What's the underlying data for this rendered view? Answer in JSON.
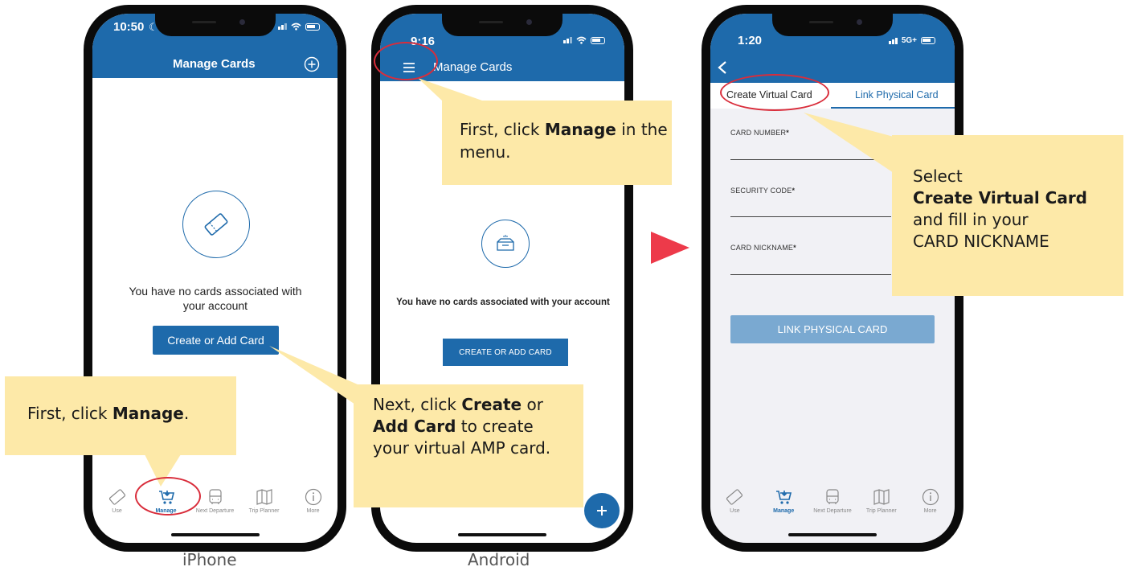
{
  "iphone": {
    "status_time": "10:50",
    "nav_title": "Manage Cards",
    "add_icon": "plus-circle-icon",
    "empty_message": "You have no cards associated with your account",
    "button_label": "Create or Add Card",
    "tabs": [
      {
        "label": "Use",
        "icon": "ticket-icon"
      },
      {
        "label": "Manage",
        "icon": "cart-icon",
        "active": true
      },
      {
        "label": "Next Departure",
        "icon": "bus-icon"
      },
      {
        "label": "Trip Planner",
        "icon": "map-icon"
      },
      {
        "label": "More",
        "icon": "info-icon"
      }
    ],
    "caption": "iPhone"
  },
  "android": {
    "status_time": "9:16",
    "nav_title": "Manage Cards",
    "menu_icon": "hamburger-icon",
    "empty_message": "You have no cards associated with your account",
    "button_label": "CREATE OR ADD CARD",
    "fab_icon": "plus-icon",
    "caption": "Android"
  },
  "virtual_card": {
    "status_time": "1:20",
    "network": "5G+",
    "back_icon": "chevron-left-icon",
    "tabs": [
      {
        "label": "Create Virtual Card"
      },
      {
        "label": "Link Physical Card",
        "active": true
      }
    ],
    "fields": [
      {
        "label": "CARD NUMBER",
        "required": "*"
      },
      {
        "label": "SECURITY CODE",
        "required": "*"
      },
      {
        "label": "CARD NICKNAME",
        "required": "*"
      }
    ],
    "submit_label": "LINK PHYSICAL CARD",
    "tabs_bottom": [
      {
        "label": "Use"
      },
      {
        "label": "Manage",
        "active": true
      },
      {
        "label": "Next Departure"
      },
      {
        "label": "Trip Planner"
      },
      {
        "label": "More"
      }
    ]
  },
  "callouts": {
    "iphone_manage": {
      "pre": "First, click ",
      "bold": "Manage",
      "post": "."
    },
    "android_menu": {
      "pre": "First, click ",
      "bold": "Manage",
      "post": " in the menu."
    },
    "create_card": {
      "pre": "Next, click ",
      "bold1": "Create",
      "mid": " or ",
      "bold2": "Add Card",
      "post": " to create your virtual AMP card."
    },
    "virtual": {
      "line1": "Select",
      "bold": "Create Virtual Card",
      "line3": "and fill in your",
      "line4": "CARD NICKNAME"
    }
  },
  "colors": {
    "brand_blue": "#1e6aab",
    "callout_yellow": "#fde9a8",
    "highlight_red": "#d92d3b",
    "disabled_button": "#7aa9d1"
  }
}
